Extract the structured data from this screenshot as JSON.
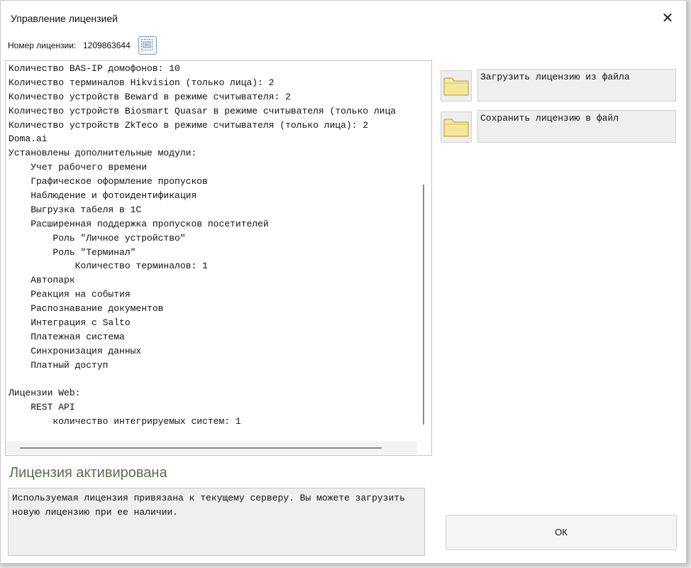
{
  "window": {
    "title": "Управление лицензией",
    "close_glyph": "✕"
  },
  "license": {
    "label": "Номер лицензии:",
    "number": "1209863644",
    "copy_icon": "license-copy-icon"
  },
  "details_lines": [
    "Количество BAS-IP домофонов: 10",
    "Количество терминалов Hikvision (только лица): 2",
    "Количество устройств Beward в режиме считывателя: 2",
    "Количество устройств Biosmart Quasar в режиме считывателя (только лица",
    "Количество устройств ZkTeco в режиме считывателя (только лица): 2",
    "Doma.ai",
    "Установлены дополнительные модули:",
    "    Учет рабочего времени",
    "    Графическое оформление пропусков",
    "    Наблюдение и фотоидентификация",
    "    Выгрузка табеля в 1С",
    "    Расширенная поддержка пропусков посетителей",
    "        Роль \"Личное устройство\"",
    "        Роль \"Терминал\"",
    "            Количество терминалов: 1",
    "    Автопарк",
    "    Реакция на события",
    "    Распознавание документов",
    "    Интеграция с Salto",
    "    Платежная система",
    "    Синхронизация данных",
    "    Платный доступ",
    "",
    "Лицензии Web:",
    "    REST API",
    "        количество интегрируемых систем: 1"
  ],
  "status": {
    "heading": "Лицензия активирована",
    "message": "Используемая лицензия привязана к текущему серверу. Вы можете загрузить новую лицензию при ее наличии."
  },
  "actions": {
    "load_label": "Загрузить лицензию из файла",
    "save_label": "Сохранить лицензию в файл",
    "folder_icon": "folder-icon"
  },
  "ok_label": "ОК",
  "colors": {
    "status_heading": "#5a6e4f",
    "folder": "#f5e79a"
  }
}
